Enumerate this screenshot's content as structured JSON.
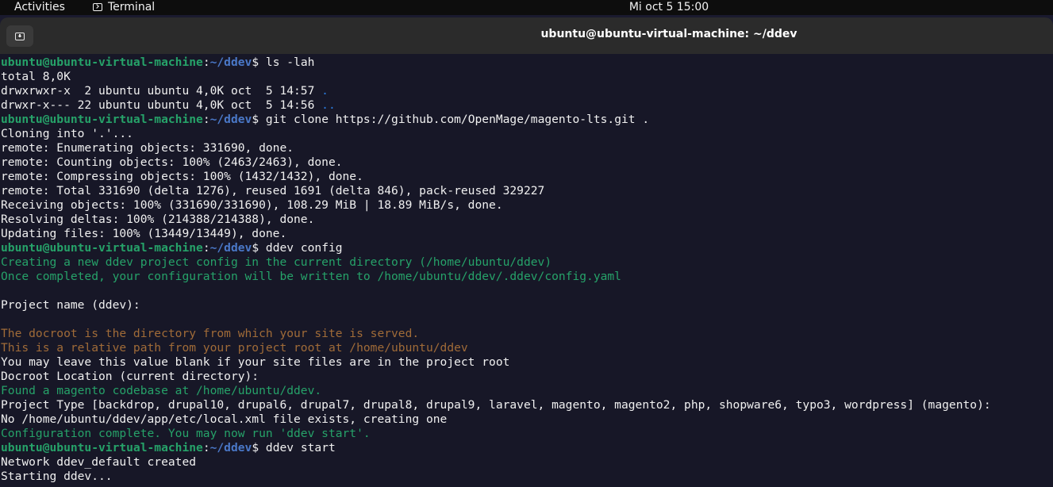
{
  "topbar": {
    "activities": "Activities",
    "app_name": "Terminal",
    "clock": "Mi oct 5  15:00"
  },
  "window": {
    "title": "ubuntu@ubuntu-virtual-machine: ~/ddev"
  },
  "terminal": {
    "prompt_user": "ubuntu@ubuntu-virtual-machine",
    "prompt_path": "~/ddev",
    "lines": [
      {
        "type": "prompt",
        "cmd": "ls -lah"
      },
      {
        "type": "text",
        "text": "total 8,0K"
      },
      {
        "type": "ls",
        "text": "drwxrwxr-x  2 ubuntu ubuntu 4,0K oct  5 14:57 ",
        "dir": "."
      },
      {
        "type": "ls",
        "text": "drwxr-x--- 22 ubuntu ubuntu 4,0K oct  5 14:56 ",
        "dir": ".."
      },
      {
        "type": "prompt",
        "cmd": "git clone https://github.com/OpenMage/magento-lts.git ."
      },
      {
        "type": "text",
        "text": "Cloning into '.'..."
      },
      {
        "type": "text",
        "text": "remote: Enumerating objects: 331690, done."
      },
      {
        "type": "text",
        "text": "remote: Counting objects: 100% (2463/2463), done."
      },
      {
        "type": "text",
        "text": "remote: Compressing objects: 100% (1432/1432), done."
      },
      {
        "type": "text",
        "text": "remote: Total 331690 (delta 1276), reused 1691 (delta 846), pack-reused 329227"
      },
      {
        "type": "text",
        "text": "Receiving objects: 100% (331690/331690), 108.29 MiB | 18.89 MiB/s, done."
      },
      {
        "type": "text",
        "text": "Resolving deltas: 100% (214388/214388), done."
      },
      {
        "type": "text",
        "text": "Updating files: 100% (13449/13449), done."
      },
      {
        "type": "prompt",
        "cmd": "ddev config"
      },
      {
        "type": "green",
        "text": "Creating a new ddev project config in the current directory (/home/ubuntu/ddev)"
      },
      {
        "type": "green",
        "text": "Once completed, your configuration will be written to /home/ubuntu/ddev/.ddev/config.yaml"
      },
      {
        "type": "text",
        "text": ""
      },
      {
        "type": "text",
        "text": "Project name (ddev):"
      },
      {
        "type": "text",
        "text": ""
      },
      {
        "type": "orange",
        "text": "The docroot is the directory from which your site is served."
      },
      {
        "type": "orange",
        "text": "This is a relative path from your project root at /home/ubuntu/ddev"
      },
      {
        "type": "text",
        "text": "You may leave this value blank if your site files are in the project root"
      },
      {
        "type": "text",
        "text": "Docroot Location (current directory):"
      },
      {
        "type": "green",
        "text": "Found a magento codebase at /home/ubuntu/ddev."
      },
      {
        "type": "text",
        "text": "Project Type [backdrop, drupal10, drupal6, drupal7, drupal8, drupal9, laravel, magento, magento2, php, shopware6, typo3, wordpress] (magento):"
      },
      {
        "type": "text",
        "text": "No /home/ubuntu/ddev/app/etc/local.xml file exists, creating one"
      },
      {
        "type": "green",
        "text": "Configuration complete. You may now run 'ddev start'."
      },
      {
        "type": "prompt",
        "cmd": "ddev start"
      },
      {
        "type": "text",
        "text": "Network ddev_default created"
      },
      {
        "type": "text",
        "text": "Starting ddev..."
      }
    ]
  }
}
